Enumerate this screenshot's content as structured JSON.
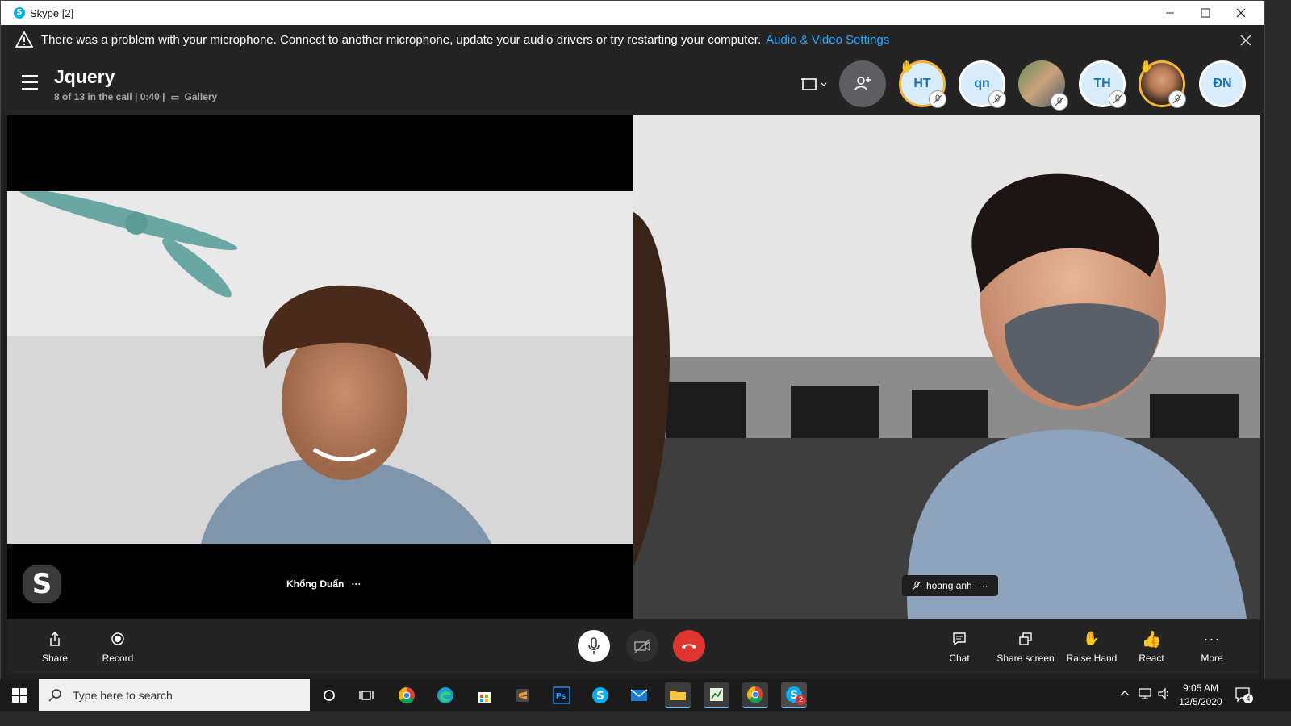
{
  "window": {
    "title": "Skype [2]",
    "min_icon": "minimize-icon",
    "max_icon": "maximize-icon",
    "close_icon": "close-icon"
  },
  "banner": {
    "message": "There was a problem with your microphone. Connect to another microphone, update your audio drivers or try restarting your computer.",
    "link": "Audio & Video Settings",
    "close_icon": "close-icon"
  },
  "call": {
    "title": "Jquery",
    "status": "8 of 13 in the call | 0:40 |",
    "view": "Gallery"
  },
  "participants": [
    {
      "initials": "HT",
      "hand_raised": true
    },
    {
      "initials": "qn",
      "hand_raised": false
    },
    {
      "initials": "",
      "photo": true,
      "hand_raised": false
    },
    {
      "initials": "TH",
      "hand_raised": false
    },
    {
      "initials": "",
      "photo": true,
      "hand_raised": true
    },
    {
      "initials": "ĐN",
      "hand_raised": false
    }
  ],
  "tiles": {
    "left_name": "Khổng Duẩn",
    "left_more": "···",
    "right_name": "hoang anh",
    "right_more": "···"
  },
  "controls": {
    "share": "Share",
    "record": "Record",
    "chat": "Chat",
    "share_screen": "Share screen",
    "raise_hand": "Raise Hand",
    "react": "React",
    "more": "More"
  },
  "taskbar": {
    "search_placeholder": "Type here to search",
    "time": "9:05 AM",
    "date": "12/5/2020",
    "notifications": "4",
    "skype_badge": "2"
  },
  "colors": {
    "accent": "#2aa8ff",
    "hangup": "#e0342f",
    "panel": "#242424"
  }
}
